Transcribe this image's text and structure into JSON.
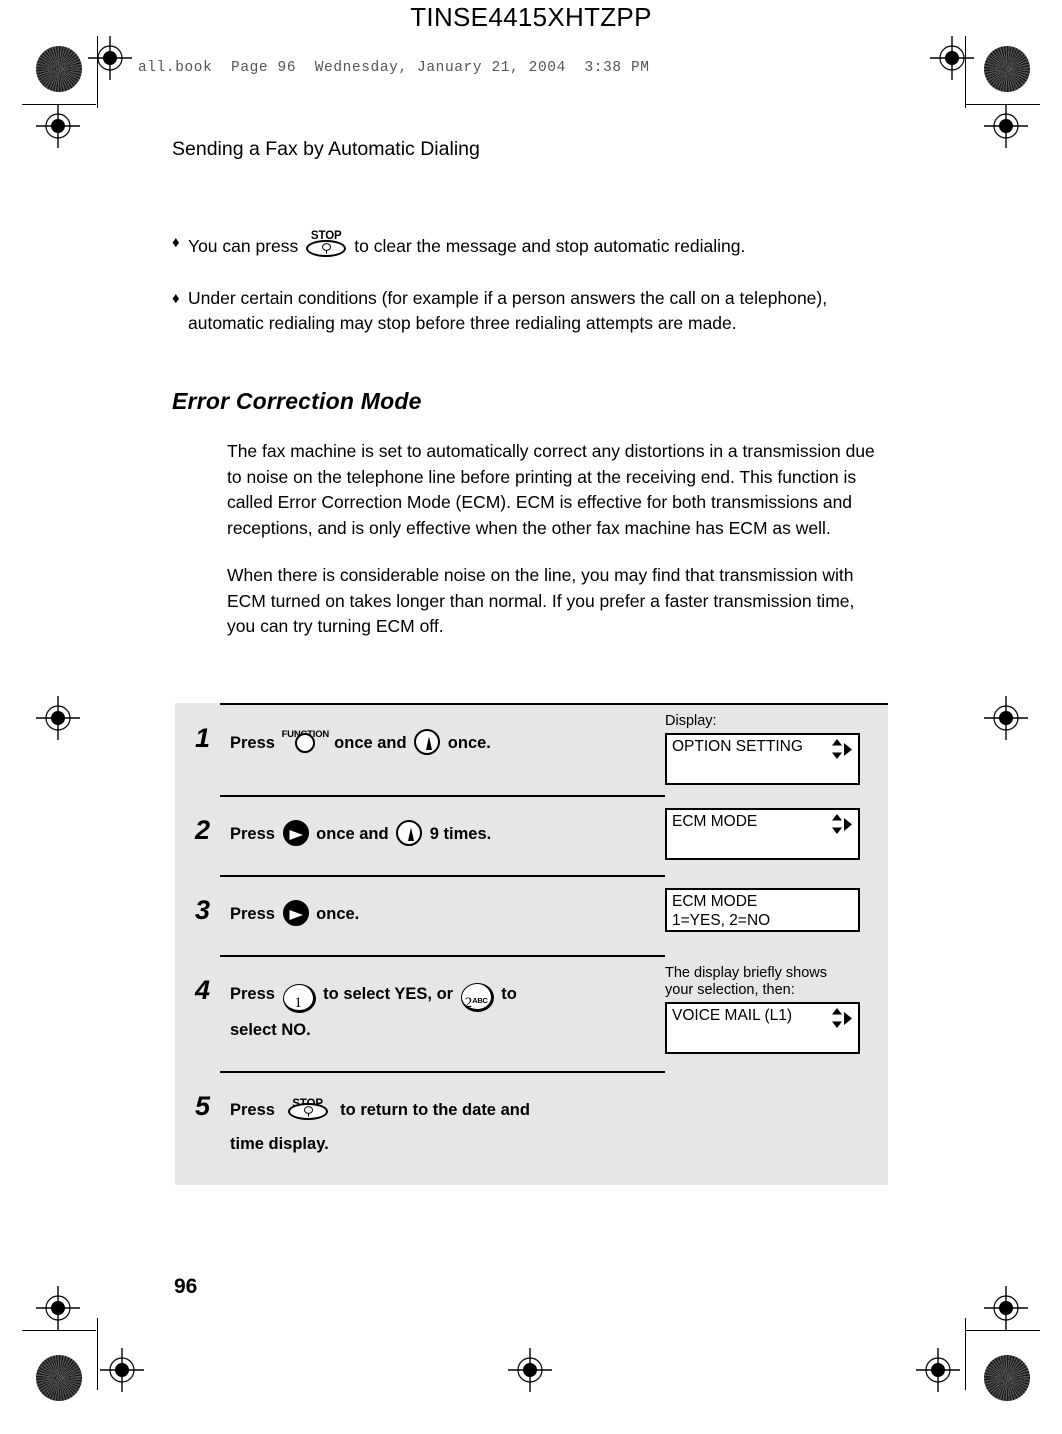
{
  "document": {
    "code": "TINSE4415XHTZPP",
    "file_line": "all.book  Page 96  Wednesday, January 21, 2004  3:38 PM",
    "running_head": "Sending a Fax by Automatic Dialing",
    "page_number": "96"
  },
  "bullets": [
    {
      "mark": "♦",
      "before": "You can press",
      "icon": "stop-button-icon",
      "after": "to clear the message and stop automatic redialing."
    },
    {
      "mark": "♦",
      "text": "Under certain conditions (for example if a person answers the call on a telephone), automatic redialing may stop before three redialing attempts are made."
    }
  ],
  "section": {
    "title": "Error Correction Mode",
    "paragraphs": [
      "The fax machine is set to automatically correct any distortions in a transmission due to noise on the telephone line before printing at the receiving end. This function is called Error Correction Mode (ECM). ECM is effective for both transmissions and receptions, and is only effective when the other fax machine has ECM as well.",
      "When there is considerable noise on the line, you may find that transmission with ECM turned on takes longer than normal. If you prefer a faster transmission time, you can try turning ECM off."
    ]
  },
  "steps": [
    {
      "number": "1",
      "text_1": "Press",
      "icon_1": "function-button-icon",
      "icon_1_label": "FUNCTION",
      "text_2": "once and",
      "icon_2": "down-arrow-button-icon",
      "text_3": "once.",
      "display_label": "Display:",
      "display_lines": [
        "OPTION SETTING"
      ],
      "display_arrows": "updown-right-arrows-icon"
    },
    {
      "number": "2",
      "text_1": "Press",
      "icon_1": "right-arrow-button-icon",
      "text_2": "once and",
      "icon_2": "down-arrow-button-icon",
      "text_3": "9 times.",
      "display_label": "",
      "display_lines": [
        "ECM MODE"
      ],
      "display_arrows": "updown-right-arrows-icon"
    },
    {
      "number": "3",
      "text_1": "Press",
      "icon_1": "right-arrow-button-icon",
      "text_2": "once.",
      "display_label": "",
      "display_lines": [
        "ECM MODE",
        "1=YES, 2=NO"
      ],
      "display_arrows": ""
    },
    {
      "number": "4",
      "text_1": "Press",
      "key_1": "1",
      "key_1_sub": "",
      "text_2": "to select YES, or",
      "key_2": "2",
      "key_2_sub": "ABC",
      "text_3": "to",
      "text_4": "select NO.",
      "display_label": "The display briefly shows your selection, then:",
      "display_lines": [
        "VOICE MAIL (L1)"
      ],
      "display_arrows": "updown-right-arrows-icon"
    },
    {
      "number": "5",
      "text_1": "Press",
      "icon_1": "stop-button-icon",
      "text_2": "to return to the date and",
      "text_3": "time display.",
      "display_label": "",
      "display_lines": [],
      "display_arrows": ""
    }
  ],
  "labels": {
    "stop": "STOP",
    "function": "FUNCTION"
  },
  "colors": {
    "panel_bg": "#e6e6e6",
    "text": "#000000",
    "file_line": "#555555"
  }
}
